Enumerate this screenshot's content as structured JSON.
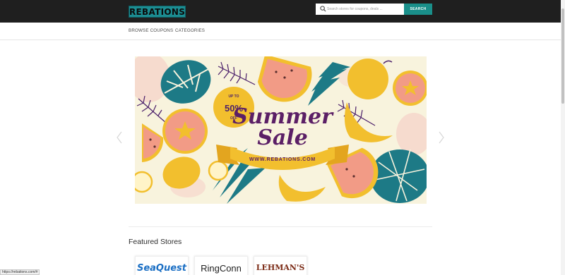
{
  "header": {
    "logo_text": "REBATIONS",
    "search": {
      "placeholder": "Search stores for coupons, deals ...",
      "button_label": "SEARCH"
    }
  },
  "nav": {
    "items": [
      {
        "label": "BROWSE COUPONS"
      },
      {
        "label": "CATEGORIES"
      }
    ]
  },
  "banner": {
    "badge_top": "UP TO",
    "badge_value": "50%",
    "badge_bottom": "OFF",
    "headline_line1": "Summer",
    "headline_line2": "Sale",
    "ribbon_text": "WWW.REBATIONS.COM"
  },
  "featured": {
    "title": "Featured Stores",
    "stores": [
      {
        "name": "SeaQuest"
      },
      {
        "name": "RingConn"
      },
      {
        "name": "LEHMAN'S"
      }
    ]
  },
  "status_bar": {
    "url": "https://rebations.com/#"
  },
  "colors": {
    "header_bg": "#1f1f1f",
    "accent_teal": "#1a8f8a",
    "banner_bg": "#f8f3dd",
    "headline_purple": "#5b1f66",
    "ribbon_yellow": "#f2bf2e"
  },
  "icons": {
    "search": "search-icon",
    "prev": "chevron-left-icon",
    "next": "chevron-right-icon"
  }
}
